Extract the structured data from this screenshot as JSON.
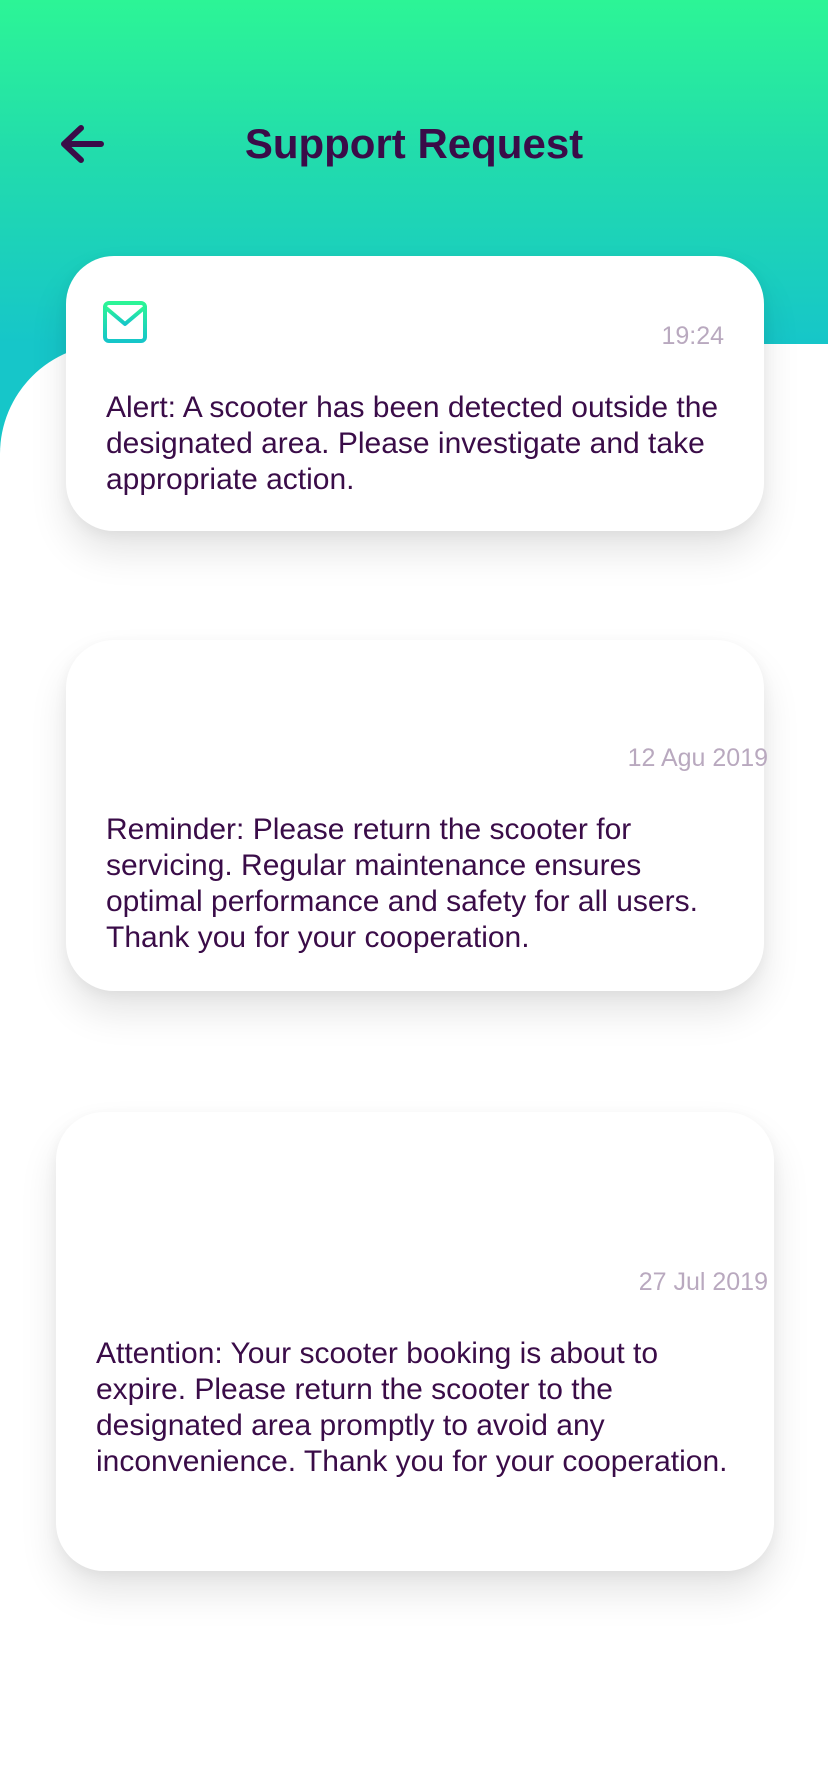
{
  "header": {
    "title": "Support Request",
    "back_icon": "arrow-left-icon"
  },
  "colors": {
    "gradient_top": "#2cf596",
    "gradient_bottom": "#16c6c9",
    "title_text": "#3a0c48",
    "timestamp_text": "#b9a9bf",
    "card_background": "#ffffff"
  },
  "messages": [
    {
      "icon": "mail-icon",
      "time": "19:24",
      "text": "Alert: A scooter has been detected outside the designated area. Please investigate and take appropriate action."
    },
    {
      "time": "12 Agu 2019",
      "text": "Reminder: Please return the scooter for servicing. Regular maintenance ensures optimal performance and safety for all users. Thank you for your cooperation."
    },
    {
      "time": "27 Jul 2019",
      "text": "Attention: Your scooter booking is about to expire. Please return the scooter to the designated area promptly to avoid any inconvenience. Thank you for your cooperation."
    }
  ]
}
